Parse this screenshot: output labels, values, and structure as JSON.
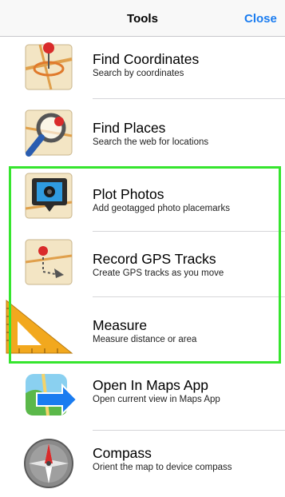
{
  "header": {
    "title": "Tools",
    "close_label": "Close"
  },
  "items": [
    {
      "title": "Find Coordinates",
      "subtitle": "Search by coordinates",
      "icon": "map-pin-icon"
    },
    {
      "title": "Find Places",
      "subtitle": "Search the web for locations",
      "icon": "magnifier-icon"
    },
    {
      "title": "Plot Photos",
      "subtitle": "Add geotagged photo placemarks",
      "icon": "camera-icon"
    },
    {
      "title": "Record GPS Tracks",
      "subtitle": "Create GPS tracks as you move",
      "icon": "gps-track-icon"
    },
    {
      "title": "Measure",
      "subtitle": "Measure distance or area",
      "icon": "ruler-icon"
    },
    {
      "title": "Open In Maps App",
      "subtitle": "Open current view in Maps App",
      "icon": "maps-app-icon"
    },
    {
      "title": "Compass",
      "subtitle": "Orient the map to device compass",
      "icon": "compass-icon"
    }
  ],
  "colors": {
    "accent": "#1a7cf0",
    "highlight": "#36e52e"
  }
}
